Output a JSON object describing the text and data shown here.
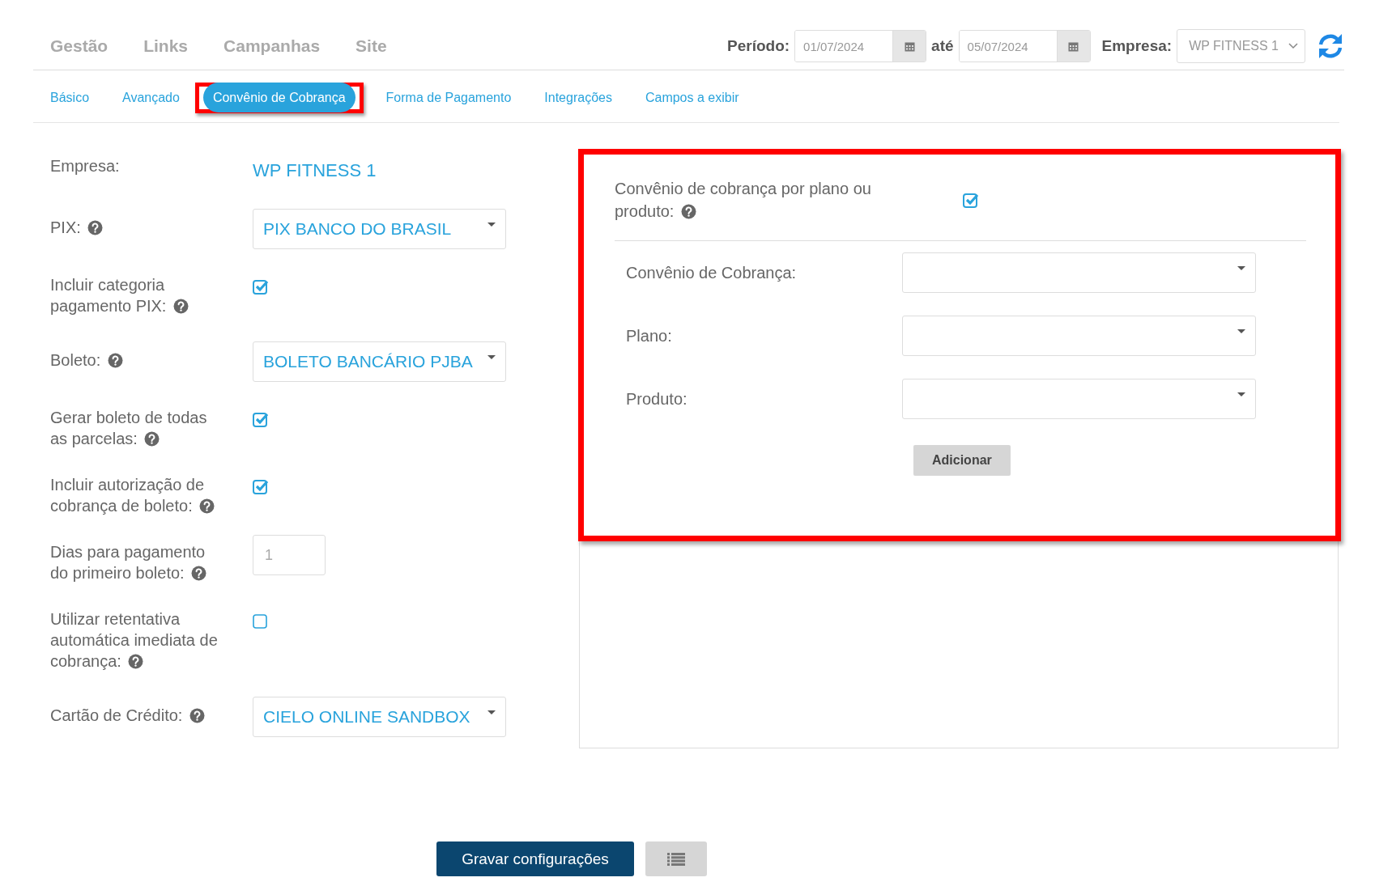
{
  "top_nav": [
    {
      "label": "Gestão"
    },
    {
      "label": "Links"
    },
    {
      "label": "Campanhas"
    },
    {
      "label": "Site"
    }
  ],
  "period": {
    "label": "Período:",
    "start": "01/07/2024",
    "separator": "até",
    "end": "05/07/2024"
  },
  "company_filter": {
    "label": "Empresa:",
    "value": "WP FITNESS 1"
  },
  "tabs": [
    {
      "label": "Básico",
      "selected": false,
      "highlighted": false
    },
    {
      "label": "Avançado",
      "selected": false,
      "highlighted": false
    },
    {
      "label": "Convênio de Cobrança",
      "selected": true,
      "highlighted": true
    },
    {
      "label": "Forma de Pagamento",
      "selected": false,
      "highlighted": false
    },
    {
      "label": "Integrações",
      "selected": false,
      "highlighted": false
    },
    {
      "label": "Campos a exibir",
      "selected": false,
      "highlighted": false
    }
  ],
  "form": [
    {
      "kind": "text",
      "label": "Empresa:",
      "help": false,
      "value": "WP FITNESS 1"
    },
    {
      "kind": "select",
      "label": "PIX:",
      "help": true,
      "value": "PIX BANCO DO BRASIL"
    },
    {
      "kind": "checkbox",
      "label": "Incluir categoria pagamento PIX:",
      "help": true,
      "checked": true
    },
    {
      "kind": "select",
      "label": "Boleto:",
      "help": true,
      "value": "BOLETO BANCÁRIO PJBA"
    },
    {
      "kind": "checkbox",
      "label": "Gerar boleto de todas as parcelas:",
      "help": true,
      "checked": true
    },
    {
      "kind": "checkbox",
      "label": "Incluir autorização de cobrança de boleto:",
      "help": true,
      "checked": true
    },
    {
      "kind": "number",
      "label": "Dias para pagamento do primeiro boleto:",
      "help": true,
      "placeholder": "1"
    },
    {
      "kind": "checkbox",
      "label": "Utilizar retentativa automática imediata de cobrança:",
      "help": true,
      "checked": false
    },
    {
      "kind": "select",
      "label": "Cartão de Crédito:",
      "help": true,
      "value": "CIELO ONLINE SANDBOX"
    }
  ],
  "plan_panel": {
    "highlighted": true,
    "toggle": {
      "label": "Convênio de cobrança por plano ou produto:",
      "help": true,
      "checked": true
    },
    "fields": [
      {
        "label": "Convênio de Cobrança:"
      },
      {
        "label": "Plano:"
      },
      {
        "label": "Produto:"
      }
    ],
    "add_button": "Adicionar"
  },
  "save_button": "Gravar configurações"
}
